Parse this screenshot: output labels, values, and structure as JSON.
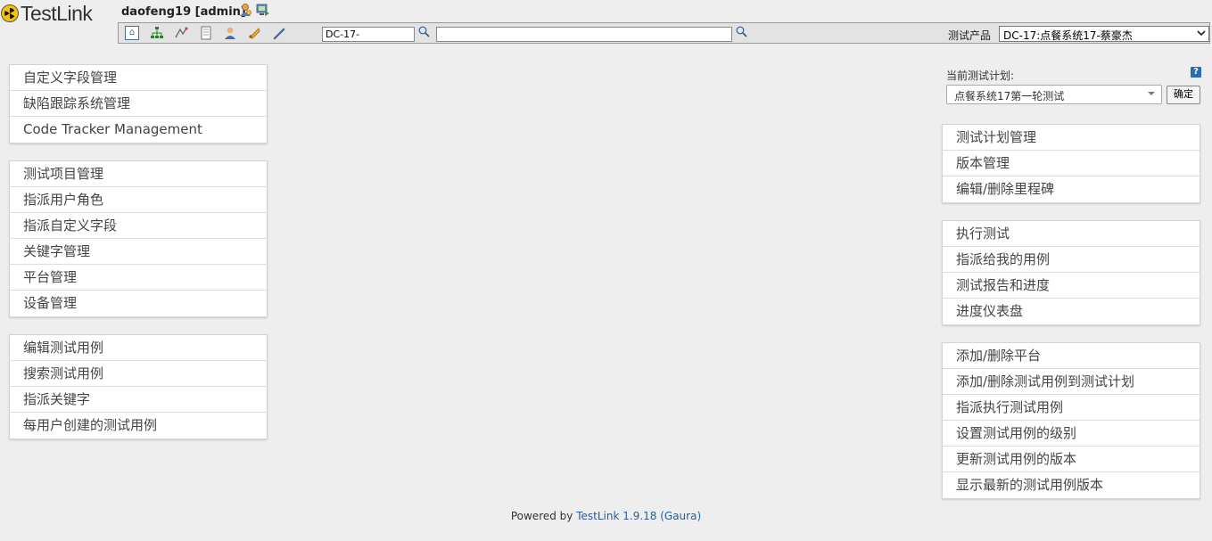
{
  "header": {
    "logo_text": "TestLink",
    "user": "daofeng19 [admin]",
    "icons": [
      "user-settings-icon",
      "logout-icon"
    ]
  },
  "toolbar": {
    "icons": [
      "home-icon",
      "tree-icon",
      "requirements-icon",
      "specification-icon",
      "user-icon",
      "events-icon",
      "tools-icon"
    ],
    "testcase_id_value": "DC-17-",
    "search_value": "",
    "product_label": "测试产品",
    "product_selected": "DC-17:点餐系统17-蔡豪杰"
  },
  "left_menus": [
    {
      "items": [
        "自定义字段管理",
        "缺陷跟踪系统管理",
        "Code Tracker Management"
      ]
    },
    {
      "items": [
        "测试项目管理",
        "指派用户角色",
        "指派自定义字段",
        "关键字管理",
        "平台管理",
        "设备管理"
      ]
    },
    {
      "items": [
        "编辑测试用例",
        "搜索测试用例",
        "指派关键字",
        "每用户创建的测试用例"
      ]
    }
  ],
  "plan": {
    "label": "当前测试计划:",
    "selected": "点餐系统17第一轮测试",
    "confirm_label": "确定",
    "help_label": "?"
  },
  "right_menus": [
    {
      "items": [
        "测试计划管理",
        "版本管理",
        "编辑/删除里程碑"
      ]
    },
    {
      "items": [
        "执行测试",
        "指派给我的用例",
        "测试报告和进度",
        "进度仪表盘"
      ]
    },
    {
      "items": [
        "添加/删除平台",
        "添加/删除测试用例到测试计划",
        "指派执行测试用例",
        "设置测试用例的级别",
        "更新测试用例的版本",
        "显示最新的测试用例版本"
      ]
    }
  ],
  "footer": {
    "prefix": "Powered by ",
    "link": "TestLink 1.9.18 (Gaura)"
  }
}
